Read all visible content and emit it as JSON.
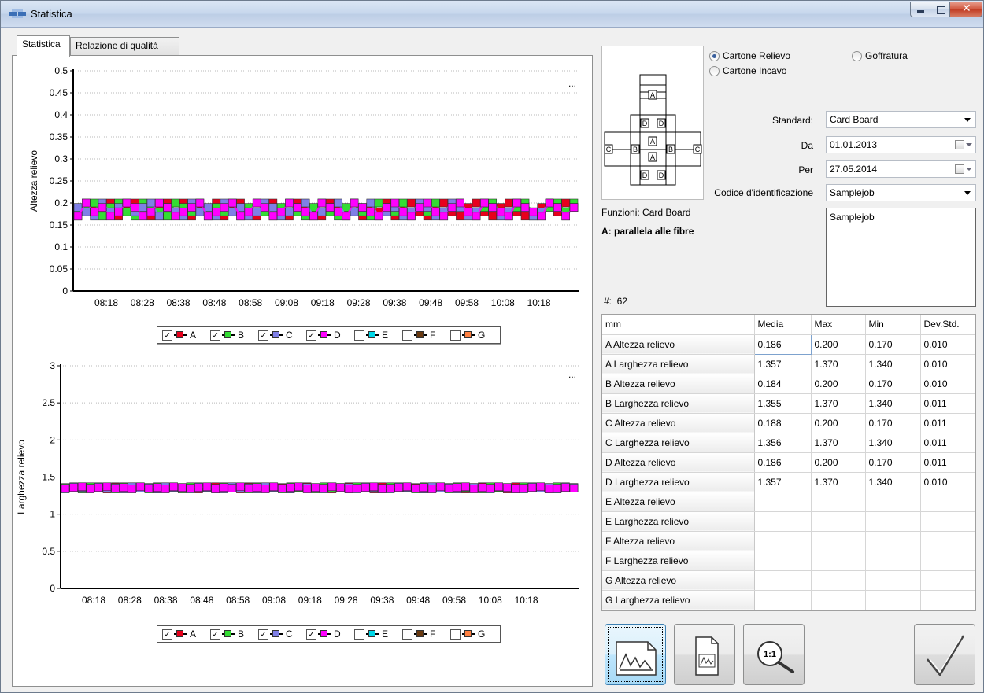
{
  "window": {
    "title": "Statistica"
  },
  "tabs": [
    {
      "label": "Statistica"
    },
    {
      "label": "Relazione di qualità"
    }
  ],
  "menu_dots": "...",
  "legend": [
    {
      "label": "A",
      "checked": true,
      "color": "#e8001c"
    },
    {
      "label": "B",
      "checked": true,
      "color": "#33dd33"
    },
    {
      "label": "C",
      "checked": true,
      "color": "#7f7fe6"
    },
    {
      "label": "D",
      "checked": true,
      "color": "#ff00ff"
    },
    {
      "label": "E",
      "checked": false,
      "color": "#00d8e8"
    },
    {
      "label": "F",
      "checked": false,
      "color": "#6b3a10"
    },
    {
      "label": "G",
      "checked": false,
      "color": "#ff8040"
    }
  ],
  "chart_data": [
    {
      "type": "line",
      "ylabel": "Altezza relievo",
      "xlabel": "",
      "ylim": [
        0,
        0.5
      ],
      "yticks": [
        "0.5",
        "0.45",
        "0.4",
        "0.35",
        "0.3",
        "0.25",
        "0.2",
        "0.15",
        "0.1",
        "0.05",
        "0"
      ],
      "xticks": [
        "08:18",
        "08:28",
        "08:38",
        "08:48",
        "08:58",
        "09:08",
        "09:18",
        "09:28",
        "09:38",
        "09:48",
        "09:58",
        "10:08",
        "10:18"
      ],
      "grid": true,
      "legend_position": "bottom",
      "series": [
        {
          "name": "A",
          "values": [
            0.17,
            0.2,
            0.19,
            0.18,
            0.2,
            0.17,
            0.19,
            0.2,
            0.18,
            0.17,
            0.19,
            0.2,
            0.18,
            0.2,
            0.17,
            0.19,
            0.18,
            0.2,
            0.17,
            0.19,
            0.2,
            0.18,
            0.17,
            0.19,
            0.2,
            0.18,
            0.17,
            0.2,
            0.19,
            0.18,
            0.17,
            0.2,
            0.19,
            0.18,
            0.2,
            0.17,
            0.19,
            0.18,
            0.2,
            0.17,
            0.19,
            0.2,
            0.18,
            0.17,
            0.19,
            0.2,
            0.18,
            0.17,
            0.19,
            0.2,
            0.18,
            0.17,
            0.19,
            0.2,
            0.18,
            0.17,
            0.17,
            0.19,
            0.2,
            0.18,
            0.2,
            0.19
          ]
        },
        {
          "name": "B",
          "values": [
            0.18,
            0.19,
            0.2,
            0.17,
            0.19,
            0.2,
            0.18,
            0.17,
            0.2,
            0.19,
            0.18,
            0.17,
            0.2,
            0.19,
            0.18,
            0.2,
            0.17,
            0.19,
            0.18,
            0.2,
            0.17,
            0.19,
            0.2,
            0.18,
            0.17,
            0.19,
            0.2,
            0.18,
            0.17,
            0.19,
            0.2,
            0.18,
            0.17,
            0.19,
            0.2,
            0.18,
            0.17,
            0.2,
            0.19,
            0.18,
            0.2,
            0.17,
            0.19,
            0.18,
            0.2,
            0.17,
            0.19,
            0.2,
            0.18,
            0.17,
            0.19,
            0.2,
            0.18,
            0.17,
            0.19,
            0.2,
            0.18,
            0.17,
            0.19,
            0.2,
            0.18,
            0.2
          ]
        },
        {
          "name": "C",
          "values": [
            0.19,
            0.18,
            0.17,
            0.2,
            0.18,
            0.19,
            0.2,
            0.18,
            0.19,
            0.2,
            0.17,
            0.19,
            0.18,
            0.17,
            0.2,
            0.18,
            0.19,
            0.17,
            0.2,
            0.18,
            0.19,
            0.17,
            0.18,
            0.2,
            0.19,
            0.17,
            0.18,
            0.19,
            0.2,
            0.17,
            0.18,
            0.19,
            0.2,
            0.17,
            0.18,
            0.19,
            0.2,
            0.17,
            0.18,
            0.19,
            0.17,
            0.18,
            0.2,
            0.19,
            0.17,
            0.18,
            0.2,
            0.19,
            0.17,
            0.18,
            0.2,
            0.19,
            0.17,
            0.18,
            0.2,
            0.19,
            0.17,
            0.18,
            0.2,
            0.19,
            0.17,
            0.19
          ]
        },
        {
          "name": "D",
          "values": [
            0.17,
            0.2,
            0.18,
            0.19,
            0.17,
            0.18,
            0.2,
            0.19,
            0.17,
            0.18,
            0.2,
            0.19,
            0.17,
            0.18,
            0.19,
            0.2,
            0.17,
            0.18,
            0.19,
            0.2,
            0.17,
            0.18,
            0.2,
            0.19,
            0.17,
            0.18,
            0.2,
            0.19,
            0.18,
            0.17,
            0.2,
            0.19,
            0.18,
            0.17,
            0.2,
            0.19,
            0.18,
            0.17,
            0.19,
            0.2,
            0.18,
            0.17,
            0.19,
            0.2,
            0.18,
            0.17,
            0.19,
            0.2,
            0.18,
            0.17,
            0.2,
            0.19,
            0.18,
            0.17,
            0.2,
            0.19,
            0.18,
            0.17,
            0.2,
            0.19,
            0.17,
            0.19
          ]
        }
      ]
    },
    {
      "type": "line",
      "ylabel": "Larghezza relievo",
      "xlabel": "",
      "ylim": [
        0,
        3
      ],
      "yticks": [
        "3",
        "2.5",
        "2",
        "1.5",
        "1",
        "0.5",
        "0"
      ],
      "xticks": [
        "08:18",
        "08:28",
        "08:38",
        "08:48",
        "08:58",
        "09:08",
        "09:18",
        "09:28",
        "09:38",
        "09:48",
        "09:58",
        "10:08",
        "10:18"
      ],
      "grid": true,
      "legend_position": "bottom",
      "series": [
        {
          "name": "A",
          "values": [
            1.35,
            1.36,
            1.37,
            1.35,
            1.36,
            1.34,
            1.37,
            1.36,
            1.35,
            1.37,
            1.36,
            1.34,
            1.35,
            1.37,
            1.36,
            1.35,
            1.34,
            1.36,
            1.37,
            1.35,
            1.36,
            1.34,
            1.37,
            1.36,
            1.35,
            1.37,
            1.36,
            1.34,
            1.35,
            1.37,
            1.36,
            1.35,
            1.34,
            1.36,
            1.37,
            1.35,
            1.36,
            1.34,
            1.37,
            1.36,
            1.35,
            1.37,
            1.36,
            1.34,
            1.35,
            1.37,
            1.36,
            1.35,
            1.34,
            1.36,
            1.37,
            1.35,
            1.36,
            1.34,
            1.37,
            1.36,
            1.35,
            1.37,
            1.36,
            1.34,
            1.35,
            1.36
          ]
        },
        {
          "name": "B",
          "values": [
            1.36,
            1.35,
            1.34,
            1.37,
            1.35,
            1.36,
            1.34,
            1.37,
            1.36,
            1.35,
            1.34,
            1.37,
            1.36,
            1.35,
            1.34,
            1.37,
            1.36,
            1.35,
            1.34,
            1.37,
            1.35,
            1.36,
            1.34,
            1.37,
            1.36,
            1.35,
            1.34,
            1.37,
            1.36,
            1.35,
            1.34,
            1.37,
            1.35,
            1.36,
            1.34,
            1.37,
            1.36,
            1.35,
            1.34,
            1.37,
            1.36,
            1.35,
            1.34,
            1.37,
            1.35,
            1.36,
            1.34,
            1.37,
            1.36,
            1.35,
            1.34,
            1.37,
            1.36,
            1.35,
            1.34,
            1.37,
            1.35,
            1.36,
            1.34,
            1.37,
            1.36,
            1.35
          ]
        },
        {
          "name": "C",
          "values": [
            1.34,
            1.37,
            1.36,
            1.35,
            1.37,
            1.35,
            1.36,
            1.34,
            1.37,
            1.35,
            1.36,
            1.34,
            1.37,
            1.36,
            1.35,
            1.34,
            1.37,
            1.36,
            1.35,
            1.34,
            1.37,
            1.35,
            1.36,
            1.34,
            1.37,
            1.36,
            1.35,
            1.34,
            1.37,
            1.36,
            1.35,
            1.34,
            1.37,
            1.35,
            1.36,
            1.34,
            1.37,
            1.36,
            1.35,
            1.34,
            1.37,
            1.36,
            1.35,
            1.34,
            1.37,
            1.35,
            1.36,
            1.34,
            1.37,
            1.36,
            1.35,
            1.34,
            1.37,
            1.36,
            1.35,
            1.34,
            1.37,
            1.35,
            1.36,
            1.34,
            1.37,
            1.36
          ]
        },
        {
          "name": "D",
          "values": [
            1.35,
            1.36,
            1.37,
            1.34,
            1.36,
            1.37,
            1.35,
            1.36,
            1.34,
            1.37,
            1.35,
            1.36,
            1.34,
            1.37,
            1.36,
            1.35,
            1.36,
            1.37,
            1.34,
            1.36,
            1.35,
            1.37,
            1.35,
            1.36,
            1.34,
            1.37,
            1.35,
            1.36,
            1.37,
            1.34,
            1.36,
            1.35,
            1.37,
            1.36,
            1.34,
            1.35,
            1.36,
            1.37,
            1.34,
            1.35,
            1.36,
            1.37,
            1.35,
            1.36,
            1.34,
            1.37,
            1.35,
            1.36,
            1.37,
            1.34,
            1.36,
            1.35,
            1.37,
            1.36,
            1.34,
            1.35,
            1.36,
            1.37,
            1.34,
            1.35,
            1.36,
            1.35
          ]
        }
      ]
    }
  ],
  "options": {
    "radio": [
      {
        "label": "Cartone Relievo",
        "checked": true
      },
      {
        "label": "Cartone Incavo",
        "checked": false
      },
      {
        "label": "Goffratura",
        "checked": false
      }
    ],
    "standard_label": "Standard:",
    "standard_value": "Card Board",
    "da_label": "Da",
    "da_value": "01.01.2013",
    "per_label": "Per",
    "per_value": "27.05.2014",
    "codice_label": "Codice d'identificazione",
    "codice_value": "Samplejob",
    "notes": "Samplejob"
  },
  "diagram": {
    "letters": [
      "A",
      "D",
      "D",
      "A",
      "C",
      "B",
      "B",
      "C",
      "A",
      "D",
      "D"
    ]
  },
  "info": {
    "funzioni": "Funzioni: Card Board",
    "direction": "A: parallela alle fibre",
    "count": "#:  62"
  },
  "table": {
    "columns": [
      "mm",
      "Media",
      "Max",
      "Min",
      "Dev.Std."
    ],
    "rows": [
      [
        "A Altezza relievo",
        "0.186",
        "0.200",
        "0.170",
        "0.010"
      ],
      [
        "A Larghezza relievo",
        "1.357",
        "1.370",
        "1.340",
        "0.010"
      ],
      [
        "B Altezza relievo",
        "0.184",
        "0.200",
        "0.170",
        "0.010"
      ],
      [
        "B Larghezza relievo",
        "1.355",
        "1.370",
        "1.340",
        "0.011"
      ],
      [
        "C Altezza relievo",
        "0.188",
        "0.200",
        "0.170",
        "0.011"
      ],
      [
        "C Larghezza relievo",
        "1.356",
        "1.370",
        "1.340",
        "0.011"
      ],
      [
        "D Altezza relievo",
        "0.186",
        "0.200",
        "0.170",
        "0.011"
      ],
      [
        "D Larghezza relievo",
        "1.357",
        "1.370",
        "1.340",
        "0.010"
      ],
      [
        "E Altezza relievo",
        "",
        "",
        "",
        ""
      ],
      [
        "E Larghezza relievo",
        "",
        "",
        "",
        ""
      ],
      [
        "F Altezza relievo",
        "",
        "",
        "",
        ""
      ],
      [
        "F Larghezza relievo",
        "",
        "",
        "",
        ""
      ],
      [
        "G Altezza relievo",
        "",
        "",
        "",
        ""
      ],
      [
        "G Larghezza relievo",
        "",
        "",
        "",
        ""
      ]
    ]
  },
  "toolbar": {
    "buttons": [
      {
        "icon": "chart-icon",
        "active": true
      },
      {
        "icon": "report-icon",
        "active": false
      },
      {
        "icon": "zoom-reset-icon",
        "active": false,
        "text": "1:1"
      },
      {
        "icon": "checkmark-icon",
        "active": false
      }
    ]
  }
}
